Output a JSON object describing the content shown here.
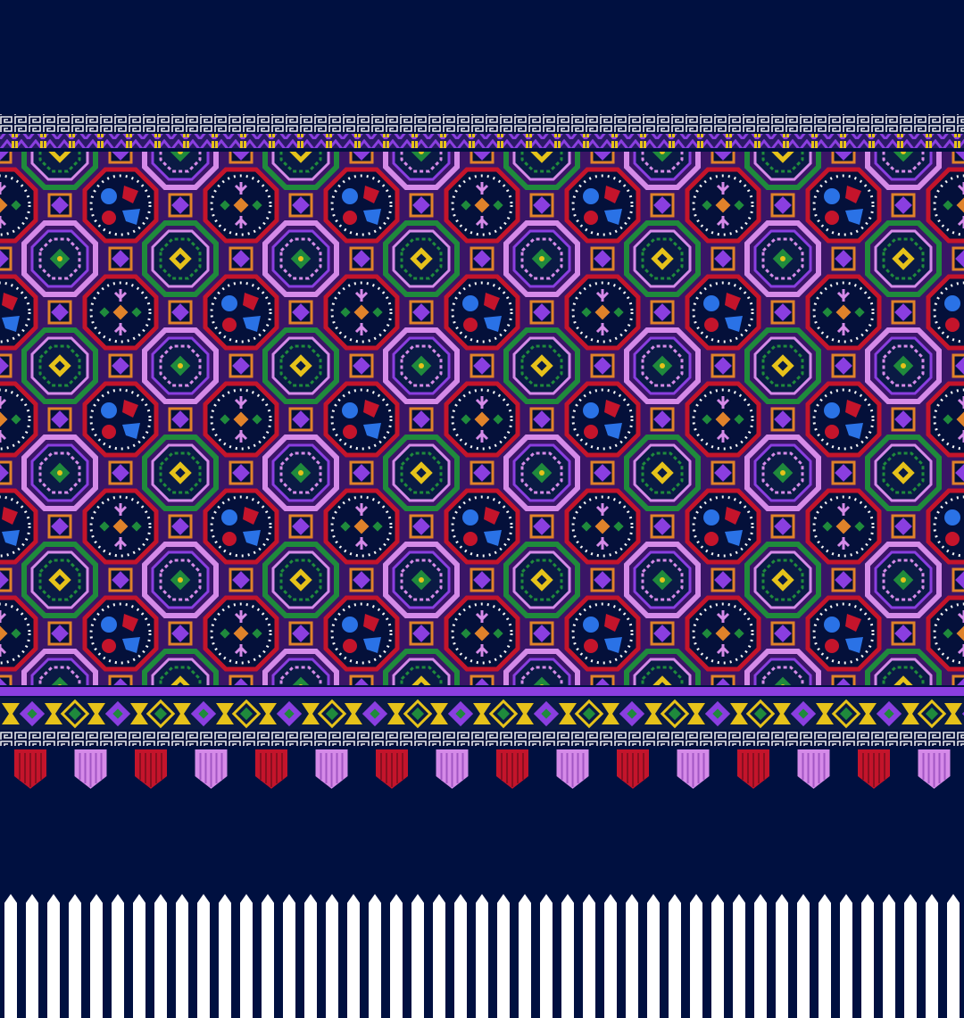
{
  "palette": {
    "background": "#001040",
    "fringe": "#ffffff",
    "navy_dark": "#04103a",
    "purple": "#8a3ee0",
    "lilac": "#d58ae8",
    "green": "#1f8a3c",
    "red": "#c4142b",
    "orange": "#e0822a",
    "yellow": "#e6c21a",
    "blue": "#2a72e6",
    "white_dot": "#f4f4f4"
  },
  "panels": [
    {
      "name": "octagon-lattice-panel",
      "motifs": [
        "octagon-medallion",
        "flower-medallion",
        "lattice-band"
      ]
    },
    {
      "name": "lower-border",
      "motifs": [
        "hourglass",
        "diamond",
        "knot"
      ]
    },
    {
      "name": "tassel-row",
      "count": 16,
      "colors": [
        "red",
        "lilac"
      ]
    },
    {
      "name": "fringe-row",
      "count": 45
    }
  ]
}
